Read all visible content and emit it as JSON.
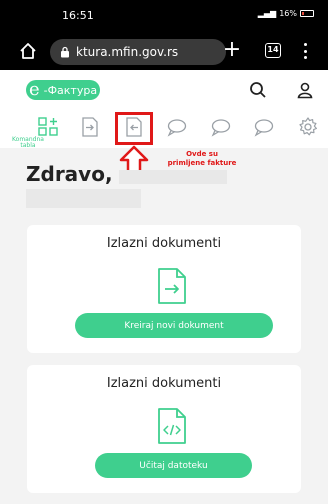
{
  "status": {
    "time": "16:51",
    "signal_battery": "16%"
  },
  "browser": {
    "url": "ktura.mfin.gov.rs",
    "tabs_count": "14"
  },
  "app": {
    "logo_letter": "e",
    "logo_text": "-Фактура"
  },
  "toolbar": {
    "dashboard_label": "Komandna tabla"
  },
  "annotation": {
    "line1": "Ovde su",
    "line2": "primljene fakture",
    "color": "#e01818"
  },
  "main": {
    "greeting": "Zdravo,"
  },
  "cards": [
    {
      "title": "Izlazni dokumenti",
      "button": "Kreiraj novi dokument",
      "icon": "document-arrow-icon"
    },
    {
      "title": "Izlazni dokumenti",
      "button": "Učitaj datoteku",
      "icon": "document-code-icon"
    }
  ],
  "colors": {
    "brand": "#3fcf8e",
    "highlight": "#e01818"
  }
}
